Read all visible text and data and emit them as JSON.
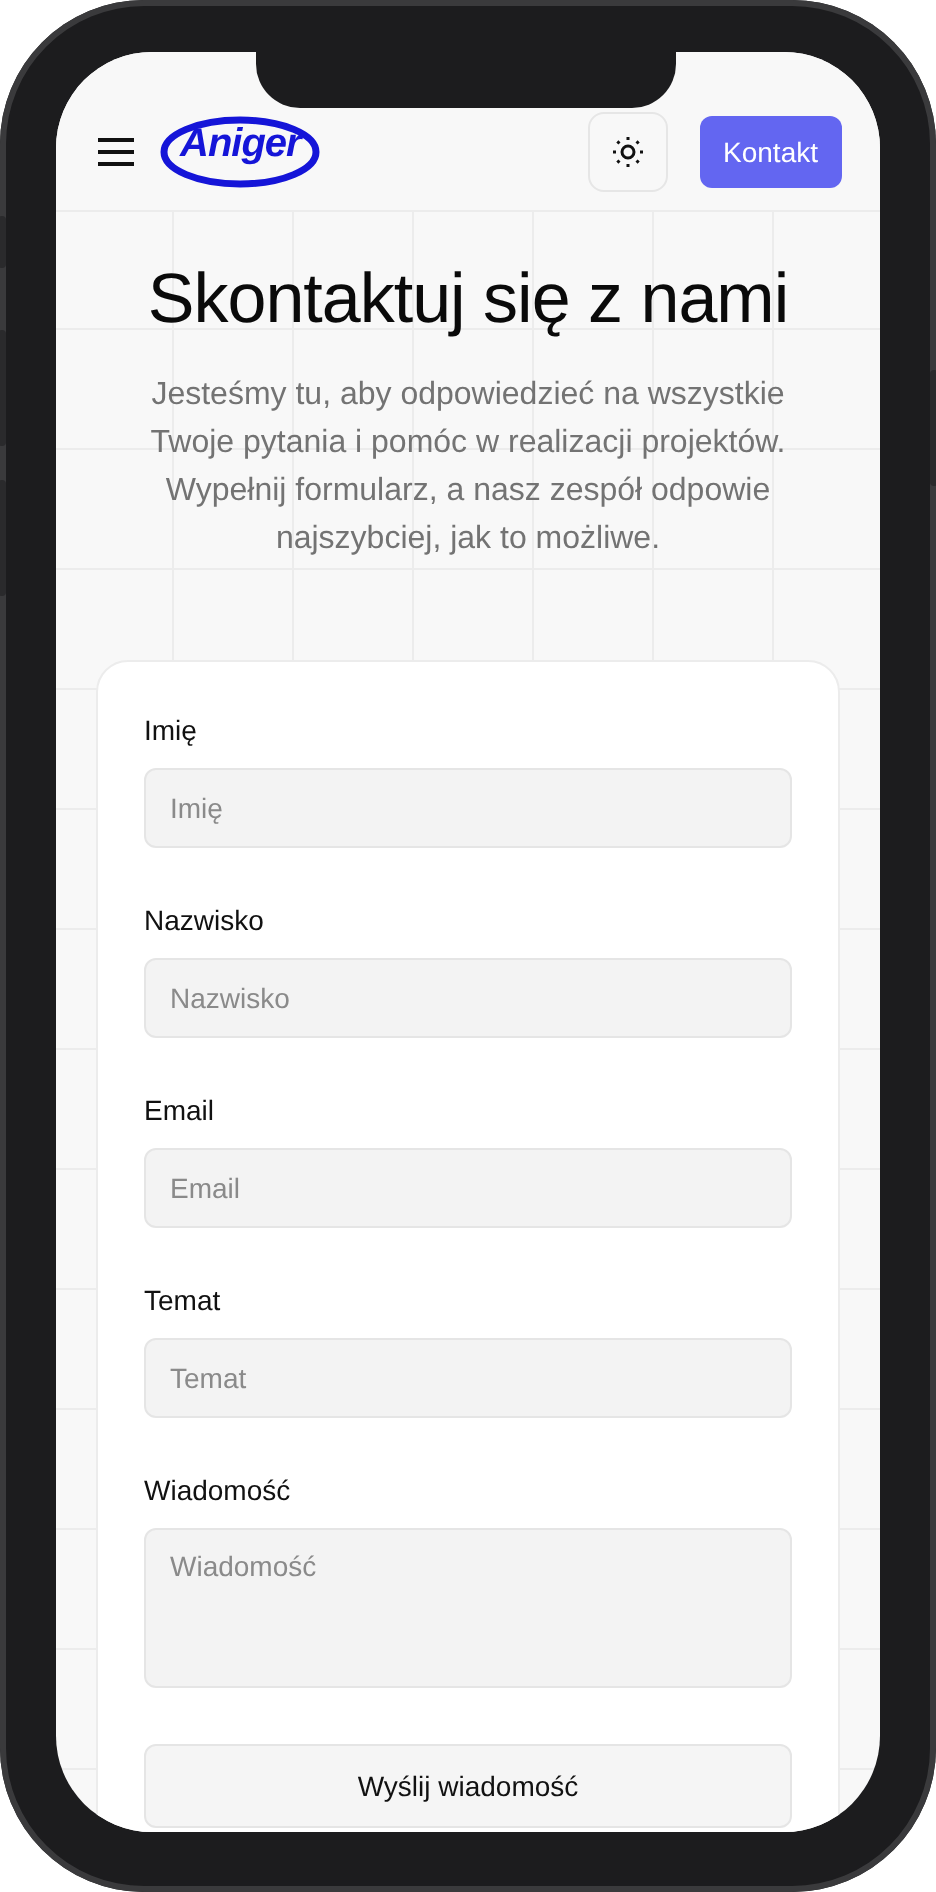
{
  "header": {
    "logo": "Aniger",
    "button": "Kontakt"
  },
  "hero": {
    "title": "Skontaktuj się z nami",
    "subtitle": "Jesteśmy tu, aby odpowiedzieć na wszystkie Twoje pytania i pomóc w realizacji projektów. Wypełnij formularz, a nasz zespół odpowie najszybciej, jak to możliwe."
  },
  "form": {
    "fields": [
      {
        "kind": "input",
        "label": "Imię",
        "placeholder": "Imię"
      },
      {
        "kind": "input",
        "label": "Nazwisko",
        "placeholder": "Nazwisko"
      },
      {
        "kind": "input",
        "label": "Email",
        "placeholder": "Email"
      },
      {
        "kind": "input",
        "label": "Temat",
        "placeholder": "Temat"
      },
      {
        "kind": "textarea",
        "label": "Wiadomość",
        "placeholder": "Wiadomość"
      }
    ],
    "submit": "Wyślij wiadomość"
  }
}
